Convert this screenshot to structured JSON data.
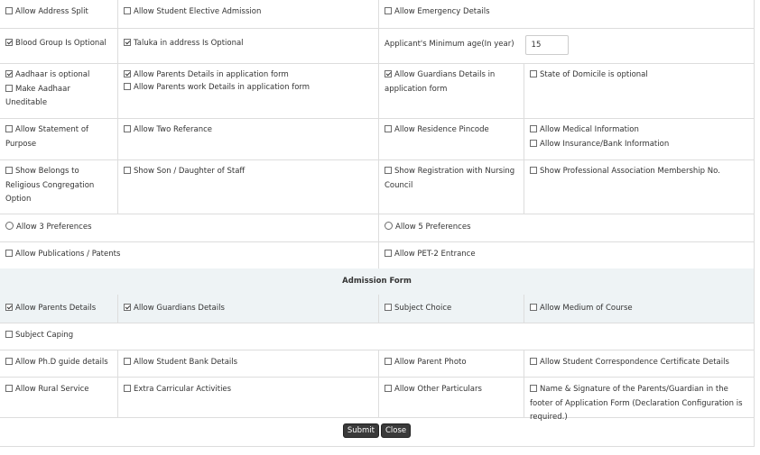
{
  "rows": [
    {
      "c1": [
        {
          "label": "Allow Address Split",
          "checked": false
        }
      ],
      "c2": [
        {
          "label": "Allow Student Elective Admission",
          "checked": false
        }
      ],
      "c34": [
        {
          "label": "Allow Emergency Details",
          "checked": false
        }
      ]
    },
    {
      "c1": [
        {
          "label": "Blood Group Is Optional",
          "checked": true
        }
      ],
      "c2": [
        {
          "label": "Taluka in address Is Optional",
          "checked": true
        }
      ],
      "c3_label": "Applicant's Minimum age(In year)",
      "c3_value": "15"
    },
    {
      "c1": [
        {
          "label": "Aadhaar is optional",
          "checked": true
        },
        {
          "label": "Make Aadhaar Uneditable",
          "checked": false
        }
      ],
      "c2": [
        {
          "label": "Allow Parents Details in application form",
          "checked": true
        },
        {
          "label": "Allow Parents work Details in application form",
          "checked": false
        }
      ],
      "c3": [
        {
          "label": "Allow Guardians Details in application form",
          "checked": true
        }
      ],
      "c4": [
        {
          "label": "State of Domicile is optional",
          "checked": false
        }
      ]
    },
    {
      "c1": [
        {
          "label": "Allow Statement of Purpose",
          "checked": false
        }
      ],
      "c2": [
        {
          "label": "Allow Two Referance",
          "checked": false
        }
      ],
      "c3": [
        {
          "label": "Allow Residence Pincode",
          "checked": false
        }
      ],
      "c4": [
        {
          "label": "Allow Medical Information",
          "checked": false
        },
        {
          "label": "Allow Insurance/Bank Information",
          "checked": false
        }
      ]
    },
    {
      "c1": [
        {
          "label": "Show Belongs to Religious Congregation Option",
          "checked": false
        }
      ],
      "c2": [
        {
          "label": "Show Son / Daughter of Staff",
          "checked": false
        }
      ],
      "c3": [
        {
          "label": "Show Registration with Nursing Council",
          "checked": false
        }
      ],
      "c4": [
        {
          "label": "Show Professional Association Membership No.",
          "checked": false
        }
      ]
    },
    {
      "radio_left": "Allow 3 Preferences",
      "radio_right": "Allow 5 Preferences"
    },
    {
      "c12": [
        {
          "label": "Allow Publications / Patents",
          "checked": false
        }
      ],
      "c34": [
        {
          "label": "Allow PET-2 Entrance",
          "checked": false
        }
      ]
    }
  ],
  "section_title": "Admission Form",
  "admission_rows": [
    {
      "c1": [
        {
          "label": "Allow Parents Details",
          "checked": true
        }
      ],
      "c2": [
        {
          "label": "Allow Guardians Details",
          "checked": true
        }
      ],
      "c3": [
        {
          "label": "Subject Choice",
          "checked": false
        }
      ],
      "c4": [
        {
          "label": "Allow Medium of Course",
          "checked": false
        }
      ]
    },
    {
      "cfull": [
        {
          "label": "Subject Caping",
          "checked": false
        }
      ]
    },
    {
      "c1": [
        {
          "label": "Allow Ph.D guide details",
          "checked": false
        }
      ],
      "c2": [
        {
          "label": "Allow Student Bank Details",
          "checked": false
        }
      ],
      "c3": [
        {
          "label": "Allow Parent Photo",
          "checked": false
        }
      ],
      "c4": [
        {
          "label": "Allow Student Correspondence Certificate Details",
          "checked": false
        }
      ]
    },
    {
      "c1": [
        {
          "label": "Allow Rural Service",
          "checked": false
        }
      ],
      "c2": [
        {
          "label": "Extra Carricular Activities",
          "checked": false
        }
      ],
      "c3": [
        {
          "label": "Allow Other Particulars",
          "checked": false
        }
      ],
      "c4": [
        {
          "label": "Name & Signature of the Parents/Guardian in the footer of Application Form (Declaration Configuration is required.)",
          "checked": false
        }
      ]
    }
  ],
  "buttons": {
    "submit": "Submit",
    "close": "Close"
  }
}
